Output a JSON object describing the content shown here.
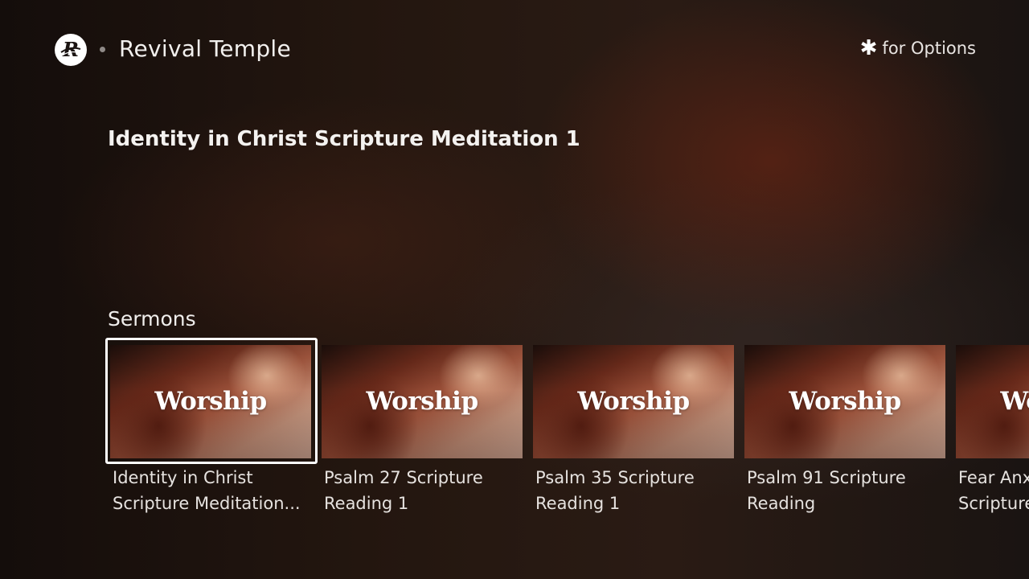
{
  "header": {
    "channel_name": "Revival Temple",
    "options_icon": "asterisk-icon",
    "options_label": "for Options",
    "logo_icon": "revival-temple-logo-icon"
  },
  "featured": {
    "title": "Identity in Christ Scripture Meditation 1"
  },
  "row": {
    "label": "Sermons",
    "items": [
      {
        "thumb_text": "Worship",
        "line1": "Identity in Christ",
        "line2": "Scripture Meditation...",
        "selected": true
      },
      {
        "thumb_text": "Worship",
        "line1": "Psalm 27 Scripture",
        "line2": "Reading 1",
        "selected": false
      },
      {
        "thumb_text": "Worship",
        "line1": "Psalm 35 Scripture",
        "line2": "Reading 1",
        "selected": false
      },
      {
        "thumb_text": "Worship",
        "line1": "Psalm 91 Scripture",
        "line2": "Reading",
        "selected": false
      },
      {
        "thumb_text": "Worship",
        "line1": "Fear Anx",
        "line2": "Scripture",
        "selected": false
      }
    ]
  }
}
